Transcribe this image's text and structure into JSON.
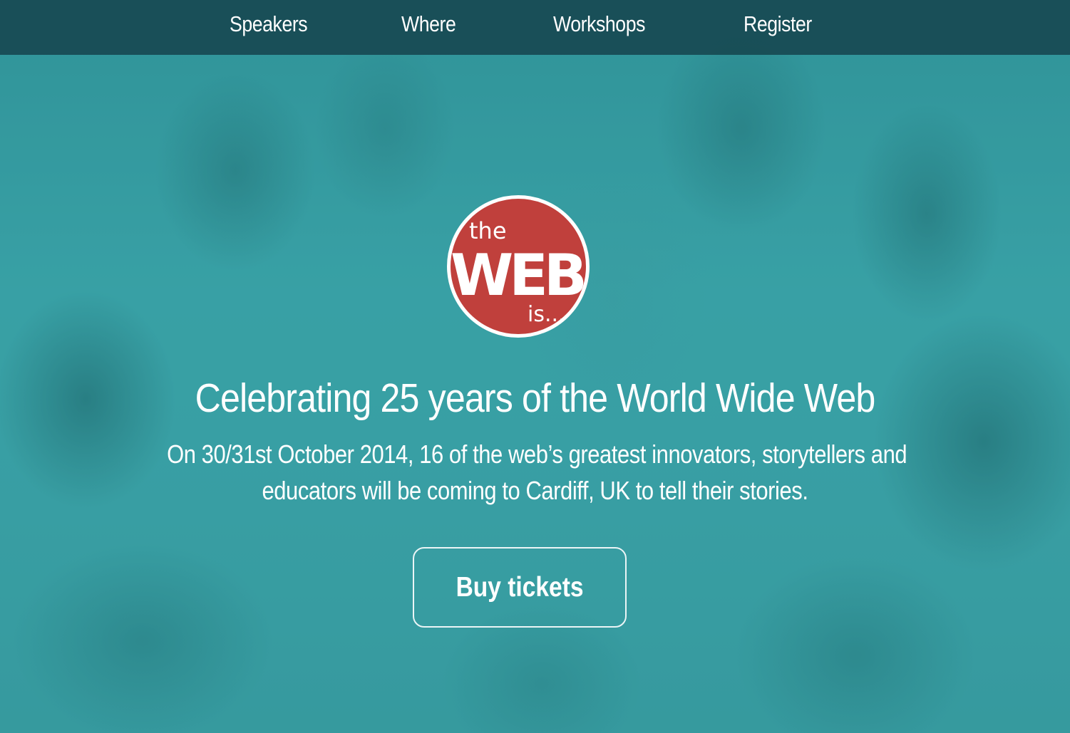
{
  "nav": {
    "items": [
      {
        "label": "Speakers"
      },
      {
        "label": "Where"
      },
      {
        "label": "Workshops"
      },
      {
        "label": "Register"
      }
    ]
  },
  "logo": {
    "text_top": "the",
    "text_main": "WEB",
    "text_bottom": "is...",
    "color": "#c0403c"
  },
  "hero": {
    "headline": "Celebrating 25 years of the World Wide Web",
    "subtext_line1": "On 30/31st October 2014, 16 of the web’s greatest innovators, storytellers and",
    "subtext_line2": "educators will be coming to Cardiff, UK to tell their stories.",
    "cta_label": "Buy tickets"
  },
  "colors": {
    "background": "#3a9ea3",
    "nav_bar": "#16464e",
    "accent": "#c0403c"
  }
}
